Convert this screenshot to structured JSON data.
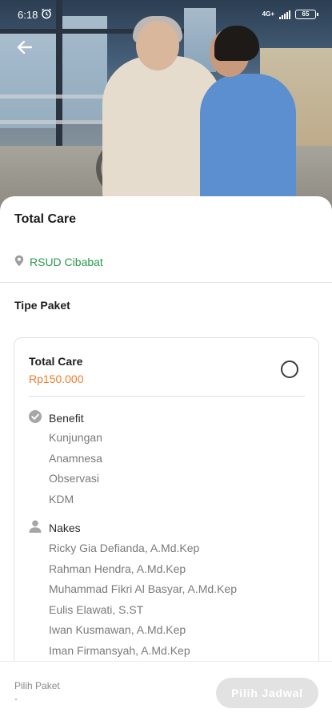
{
  "status_bar": {
    "time": "6:18",
    "network_label": "4G+",
    "battery": "65",
    "icons": [
      "alarm-icon",
      "signal-icon",
      "battery-icon"
    ]
  },
  "header": {
    "back_icon": "arrow-left-icon",
    "hero_image": "elderly patient in wheelchair with nurse"
  },
  "service": {
    "title": "Total Care",
    "location_icon": "map-pin-icon",
    "location": "RSUD Cibabat"
  },
  "package_section": {
    "title": "Tipe Paket",
    "packages": [
      {
        "name": "Total Care",
        "price": "Rp150.000",
        "selected": false,
        "benefit": {
          "icon": "check-circle-icon",
          "label": "Benefit",
          "items": [
            "Kunjungan",
            "Anamnesa",
            "Observasi",
            "KDM"
          ]
        },
        "nakes": {
          "icon": "person-icon",
          "label": "Nakes",
          "items": [
            "Ricky Gia Defianda, A.Md.Kep",
            "Rahman Hendra, A.Md.Kep",
            "Muhammad Fikri Al Basyar, A.Md.Kep",
            "Eulis Elawati, S.ST",
            "Iwan Kusmawan, A.Md.Kep",
            "Iman Firmansyah, A.Md.Kep"
          ]
        }
      }
    ]
  },
  "bottom_bar": {
    "label": "Pilih Paket",
    "value": "-",
    "button_label": "Pilih Jadwal",
    "button_enabled": false
  },
  "colors": {
    "location": "#2b9a4e",
    "price": "#f07a2b",
    "button_disabled": "#e2e2e2"
  }
}
